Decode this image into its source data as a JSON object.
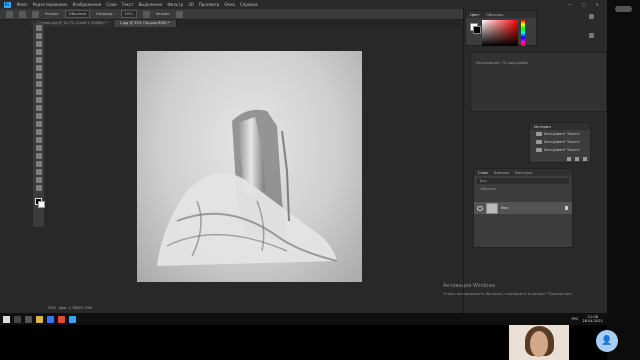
{
  "app": {
    "logo": "Ps"
  },
  "menu": [
    "Файл",
    "Редактирование",
    "Изображение",
    "Слои",
    "Текст",
    "Выделение",
    "Фильтр",
    "3D",
    "Просмотр",
    "Окно",
    "Справка"
  ],
  "window_controls": [
    "—",
    "□",
    "✕"
  ],
  "options": {
    "mode_label": "Режим:",
    "mode_value": "Обычные",
    "opacity_label": "Непрозр.:",
    "opacity_value": "10%",
    "flow_label": "Нажим:",
    "flow_value": ""
  },
  "tabs": [
    {
      "label": "Снимок.jpg @ 16,7% (Слой 1, RGB/8) *",
      "active": false
    },
    {
      "label": "2.jpg @ 33% (Эр.рир.RGB) *",
      "active": true
    }
  ],
  "status": {
    "zoom": "33%",
    "doc": "Док: 1,78М/2,79М"
  },
  "color_panel": {
    "tab_color": "Цвет",
    "tab_swatches": "Образцы"
  },
  "library": {
    "text": "Разрешение: 72 пикс/дюйм"
  },
  "right_column": [
    "",
    "",
    ""
  ],
  "history": {
    "title": "История",
    "rows": [
      "Инструмент \"Кисть\"",
      "Инструмент \"Кисть\"",
      "Инструмент \"Кисть\""
    ]
  },
  "layers": {
    "tabs": [
      "Слои",
      "Каналы",
      "Контуры"
    ],
    "search": "Вид",
    "blend": "Обычные",
    "layer_name": "Фон"
  },
  "activation": {
    "line1": "Активация Windows",
    "line2": "Чтобы активировать Windows, перейдите в раздел \"Параметры\"."
  },
  "taskbar": {
    "lang": "РУС",
    "time": "21:08",
    "date": "28.04.2021"
  }
}
